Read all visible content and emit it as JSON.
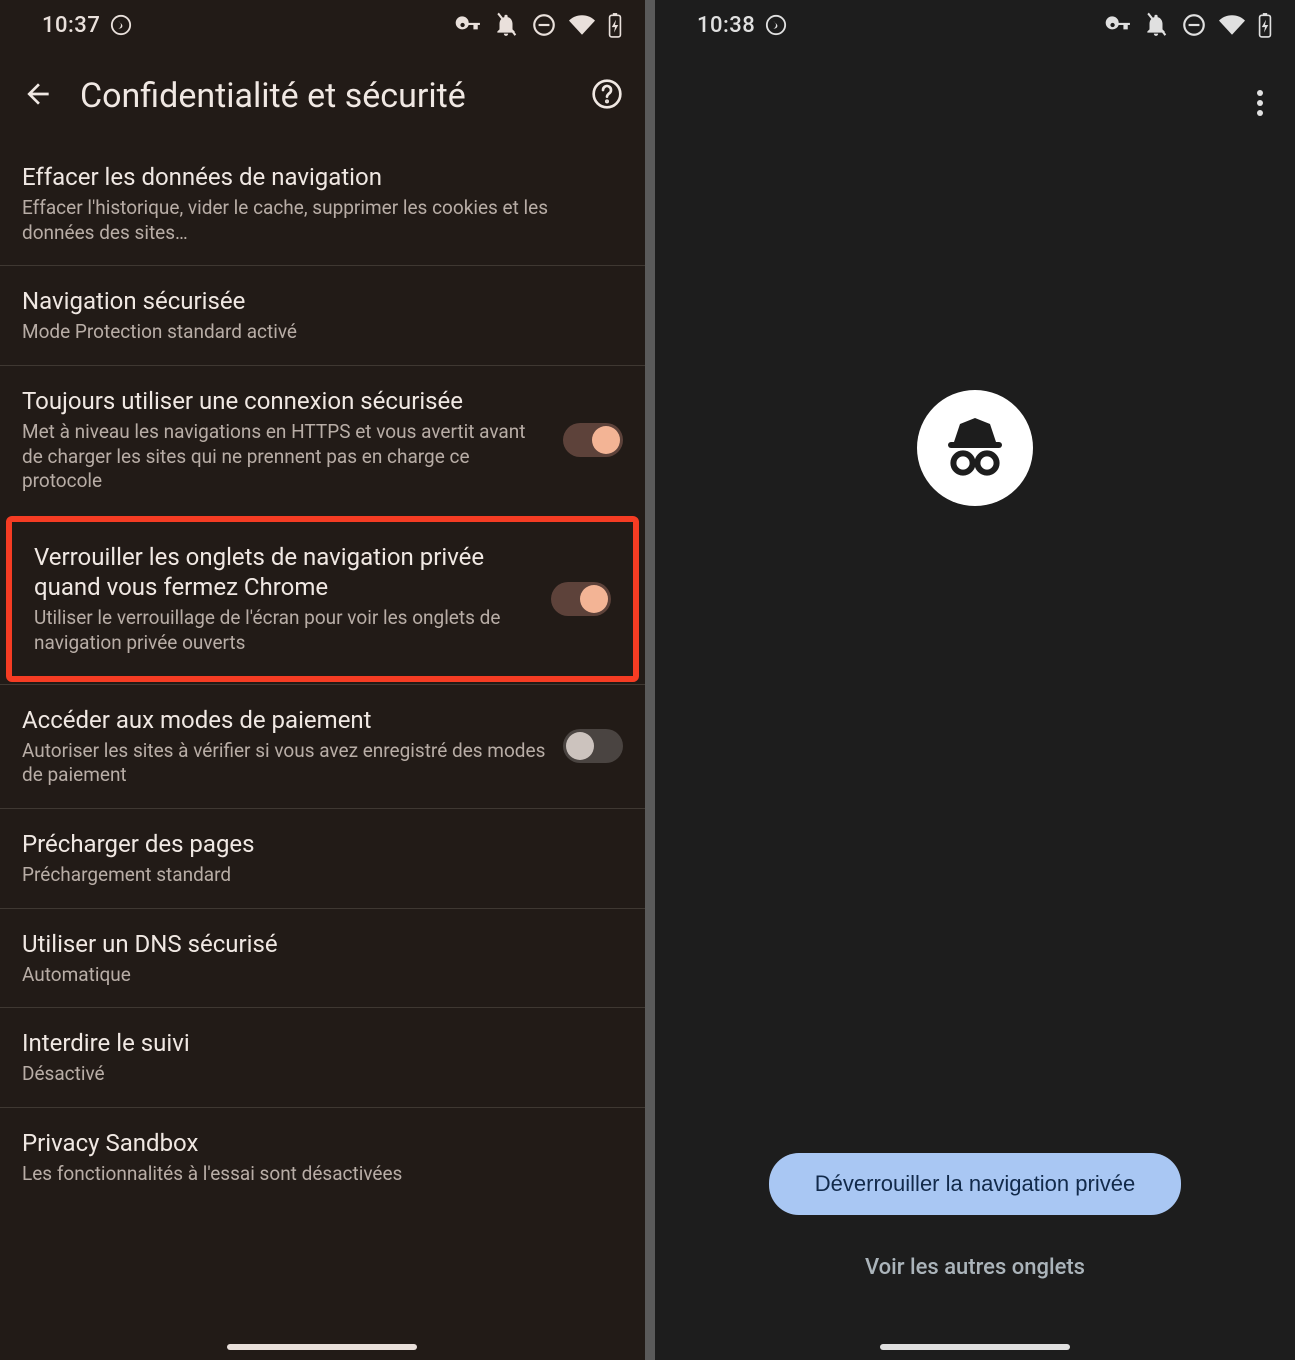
{
  "left": {
    "status": {
      "time": "10:37"
    },
    "header": {
      "title": "Confidentialité et sécurité"
    },
    "items": [
      {
        "title": "Effacer les données de navigation",
        "subtitle": "Effacer l'historique, vider le cache, supprimer les cookies et les données des sites…",
        "toggle": null
      },
      {
        "title": "Navigation sécurisée",
        "subtitle": "Mode Protection standard activé",
        "toggle": null
      },
      {
        "title": "Toujours utiliser une connexion sécurisée",
        "subtitle": "Met à niveau les navigations en HTTPS et vous avertit avant de charger les sites qui ne prennent pas en charge ce protocole",
        "toggle": "on"
      },
      {
        "title": "Verrouiller les onglets de navigation privée quand vous fermez Chrome",
        "subtitle": "Utiliser le verrouillage de l'écran pour voir les onglets de navigation privée ouverts",
        "toggle": "on",
        "highlighted": true
      },
      {
        "title": "Accéder aux modes de paiement",
        "subtitle": "Autoriser les sites à vérifier si vous avez enregistré des modes de paiement",
        "toggle": "off"
      },
      {
        "title": "Précharger des pages",
        "subtitle": "Préchargement standard",
        "toggle": null
      },
      {
        "title": "Utiliser un DNS sécurisé",
        "subtitle": "Automatique",
        "toggle": null
      },
      {
        "title": "Interdire le suivi",
        "subtitle": "Désactivé",
        "toggle": null
      },
      {
        "title": "Privacy Sandbox",
        "subtitle": "Les fonctionnalités à l'essai sont désactivées",
        "toggle": null
      }
    ]
  },
  "right": {
    "status": {
      "time": "10:38"
    },
    "unlock_label": "Déverrouiller la navigation privée",
    "see_tabs_label": "Voir les autres onglets"
  },
  "colors": {
    "accent_toggle": "#f3b495",
    "highlight": "#f53c23",
    "unlock_bg": "#a9c7f3"
  }
}
